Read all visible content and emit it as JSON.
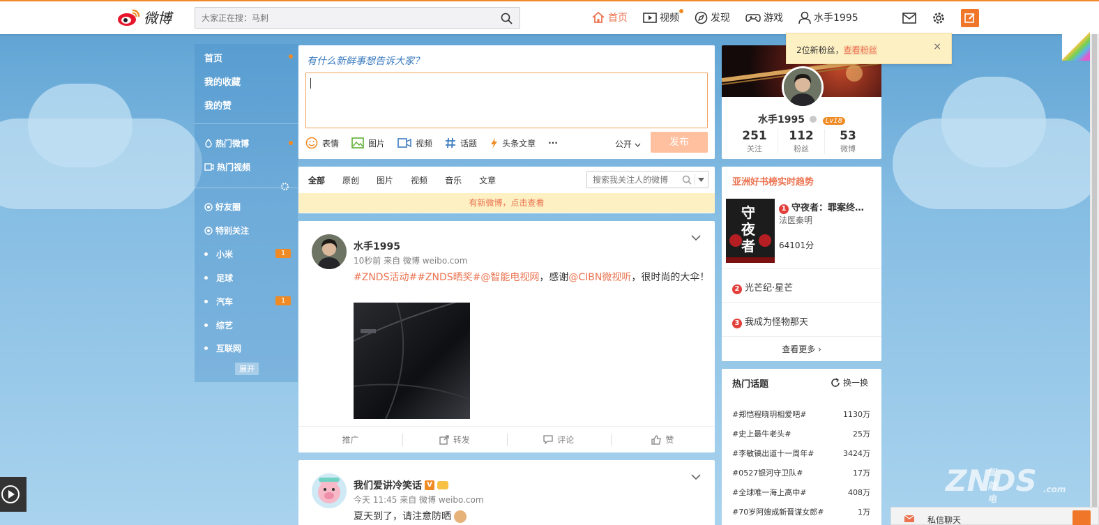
{
  "header": {
    "logo_text": "微博",
    "search_placeholder": "大家正在搜：马刺",
    "nav": [
      {
        "label": "首页",
        "icon": "home-icon"
      },
      {
        "label": "视频",
        "icon": "video-icon"
      },
      {
        "label": "发现",
        "icon": "compass-icon"
      },
      {
        "label": "游戏",
        "icon": "gamepad-icon"
      },
      {
        "label": "水手1995",
        "icon": "user-icon"
      }
    ]
  },
  "leftnav": {
    "top_items": [
      "首页",
      "我的收藏",
      "我的赞"
    ],
    "hot_items": [
      "热门微博",
      "热门视频"
    ],
    "group_items": [
      "好友圈",
      "特别关注"
    ],
    "groups": [
      {
        "label": "小米",
        "badge": "1"
      },
      {
        "label": "足球",
        "badge": ""
      },
      {
        "label": "汽车",
        "badge": "1"
      },
      {
        "label": "综艺",
        "badge": ""
      },
      {
        "label": "互联网",
        "badge": ""
      }
    ],
    "expand_label": "展开"
  },
  "publisher": {
    "title": "有什么新鲜事想告诉大家？",
    "tools": [
      "表情",
      "图片",
      "视频",
      "话题",
      "头条文章"
    ],
    "more": "···",
    "visibility": "公开",
    "submit": "发布"
  },
  "filter": {
    "tabs": [
      "全部",
      "原创",
      "图片",
      "视频",
      "音乐",
      "文章"
    ],
    "search_placeholder": "搜索我关注人的微博",
    "new_notice": "有新微博，点击查看"
  },
  "feed": [
    {
      "name": "水手1995",
      "meta": "10秒前 来自 微博 weibo.com",
      "text_parts": [
        {
          "t": "#ZNDS活动##ZNDS晒奖#@智能电视网",
          "hl": true
        },
        {
          "t": "，感谢",
          "hl": false
        },
        {
          "t": "@CIBN微视听",
          "hl": true
        },
        {
          "t": "，很时尚的大伞！",
          "hl": false
        }
      ],
      "actions": [
        "推广",
        "转发",
        "评论",
        "赞"
      ]
    },
    {
      "name": "我们爱讲冷笑话",
      "meta": "今天 11:45 来自 微博 weibo.com",
      "text": "夏天到了，请注意防晒"
    }
  ],
  "profile": {
    "name": "水手1995",
    "level": "Lv18",
    "stats": [
      {
        "n": "251",
        "l": "关注"
      },
      {
        "n": "112",
        "l": "粉丝"
      },
      {
        "n": "53",
        "l": "微博"
      }
    ]
  },
  "books": {
    "title": "亚洲好书榜实时趋势",
    "items": [
      {
        "rank": "1",
        "title": "守夜者：罪案终…",
        "author": "法医秦明",
        "score": "64101分",
        "cover_text": "守夜者"
      },
      {
        "rank": "2",
        "title": "光芒纪·星芒"
      },
      {
        "rank": "3",
        "title": "我成为怪物那天"
      }
    ],
    "more": "查看更多 ›"
  },
  "topics": {
    "title": "热门话题",
    "refresh": "换一换",
    "items": [
      {
        "t": "#郑恺程晓玥相爱吧#",
        "v": "1130万"
      },
      {
        "t": "#史上最牛老头#",
        "v": "25万"
      },
      {
        "t": "#李敏镐出道十一周年#",
        "v": "3424万"
      },
      {
        "t": "#0527银河守卫队#",
        "v": "17万"
      },
      {
        "t": "#全球唯一海上高中#",
        "v": "408万"
      },
      {
        "t": "#70岁阿嫂成新晋谋女郎#",
        "v": "1万"
      }
    ]
  },
  "notify": {
    "text": "2位新粉丝，",
    "link": "查看粉丝",
    "close": "×"
  },
  "chat": {
    "label": "私信聊天"
  },
  "watermark": {
    "main": "ZNDS",
    "sub": "智能电视网",
    "com": ".com"
  },
  "colors": {
    "accent": "#eb7350",
    "orange": "#f08a24",
    "link": "#3b7bbf"
  }
}
